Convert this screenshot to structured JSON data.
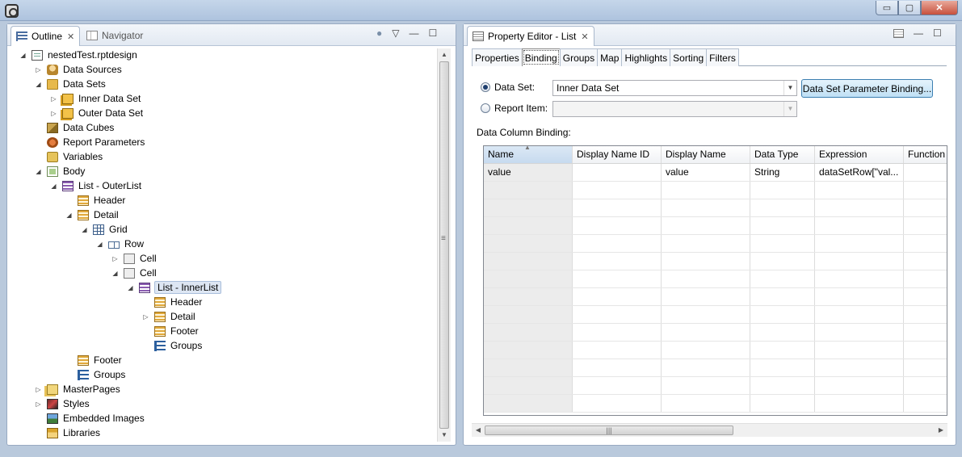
{
  "window": {
    "controls": {
      "minimize": "▭",
      "maximize": "▢",
      "close": "✕"
    }
  },
  "left_panel": {
    "tabs": [
      {
        "label": "Outline",
        "close": "✕",
        "icon": "outline-icon"
      },
      {
        "label": "Navigator",
        "icon": "navigator-icon"
      }
    ],
    "tools": {
      "filter": "●",
      "menu": "▽",
      "minimize": "—",
      "maximize": "☐"
    },
    "tree": [
      {
        "label": "nestedTest.rptdesign",
        "level": 0,
        "toggle": "◢",
        "icon": "report-file-icon"
      },
      {
        "label": "Data Sources",
        "level": 1,
        "toggle": "▷",
        "icon": "data-sources-icon"
      },
      {
        "label": "Data Sets",
        "level": 1,
        "toggle": "◢",
        "icon": "data-sets-icon"
      },
      {
        "label": "Inner Data Set",
        "level": 2,
        "toggle": "▷",
        "icon": "data-set-icon"
      },
      {
        "label": "Outer Data Set",
        "level": 2,
        "toggle": "▷",
        "icon": "data-set-icon"
      },
      {
        "label": "Data Cubes",
        "level": 1,
        "toggle": "",
        "icon": "data-cubes-icon"
      },
      {
        "label": "Report Parameters",
        "level": 1,
        "toggle": "",
        "icon": "report-parameters-icon"
      },
      {
        "label": "Variables",
        "level": 1,
        "toggle": "",
        "icon": "variables-icon"
      },
      {
        "label": "Body",
        "level": 1,
        "toggle": "◢",
        "icon": "body-icon"
      },
      {
        "label": "List - OuterList",
        "level": 2,
        "toggle": "◢",
        "icon": "list-icon"
      },
      {
        "label": "Header",
        "level": 3,
        "toggle": "",
        "icon": "band-icon"
      },
      {
        "label": "Detail",
        "level": 3,
        "toggle": "◢",
        "icon": "band-icon"
      },
      {
        "label": "Grid",
        "level": 4,
        "toggle": "◢",
        "icon": "grid-icon"
      },
      {
        "label": "Row",
        "level": 5,
        "toggle": "◢",
        "icon": "row-icon"
      },
      {
        "label": "Cell",
        "level": 6,
        "toggle": "▷",
        "icon": "cell-icon"
      },
      {
        "label": "Cell",
        "level": 6,
        "toggle": "◢",
        "icon": "cell-icon"
      },
      {
        "label": "List - InnerList",
        "level": 7,
        "toggle": "◢",
        "icon": "list-icon",
        "selected": true
      },
      {
        "label": "Header",
        "level": 8,
        "toggle": "",
        "icon": "band-icon"
      },
      {
        "label": "Detail",
        "level": 8,
        "toggle": "▷",
        "icon": "band-icon"
      },
      {
        "label": "Footer",
        "level": 8,
        "toggle": "",
        "icon": "band-icon"
      },
      {
        "label": "Groups",
        "level": 8,
        "toggle": "",
        "icon": "groups-icon"
      },
      {
        "label": "Footer",
        "level": 3,
        "toggle": "",
        "icon": "band-icon"
      },
      {
        "label": "Groups",
        "level": 3,
        "toggle": "",
        "icon": "groups-icon"
      },
      {
        "label": "MasterPages",
        "level": 1,
        "toggle": "▷",
        "icon": "master-pages-icon"
      },
      {
        "label": "Styles",
        "level": 1,
        "toggle": "▷",
        "icon": "styles-icon"
      },
      {
        "label": "Embedded Images",
        "level": 1,
        "toggle": "",
        "icon": "embedded-images-icon"
      },
      {
        "label": "Libraries",
        "level": 1,
        "toggle": "",
        "icon": "libraries-icon"
      }
    ],
    "scroll": {
      "up": "▲",
      "down": "▼"
    }
  },
  "right_panel": {
    "tab": {
      "label": "Property Editor - List",
      "close": "✕",
      "icon": "property-editor-icon"
    },
    "tools": {
      "minimize": "—",
      "maximize": "☐"
    },
    "sub_tabs": [
      "Properties",
      "Binding",
      "Groups",
      "Map",
      "Highlights",
      "Sorting",
      "Filters"
    ],
    "active_sub_tab": "Binding",
    "data_set": {
      "label": "Data Set:",
      "value": "Inner Data Set",
      "checked": true
    },
    "report_item": {
      "label": "Report Item:",
      "value": "",
      "checked": false
    },
    "dropdown_arrow": "▼",
    "param_binding_button": "Data Set Parameter Binding...",
    "section_label": "Data Column Binding:",
    "table": {
      "columns": [
        "Name",
        "Display Name ID",
        "Display Name",
        "Data Type",
        "Expression",
        "Function"
      ],
      "sort_indicator": "▲",
      "rows": [
        [
          "value",
          "",
          "value",
          "String",
          "dataSetRow[\"val...",
          ""
        ]
      ],
      "empty_rows": 13
    },
    "hscroll": {
      "left": "◀",
      "right": "▶",
      "grip": "|||"
    }
  }
}
